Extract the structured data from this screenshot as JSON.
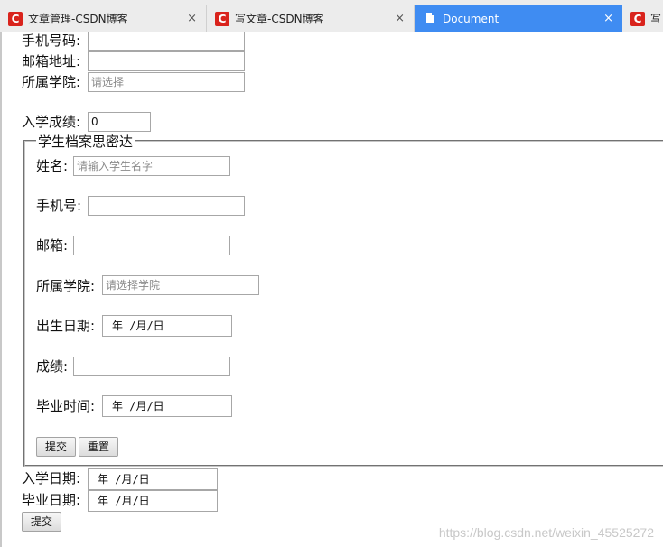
{
  "tabs": [
    {
      "title": "文章管理-CSDN博客",
      "favicon": "C"
    },
    {
      "title": "写文章-CSDN博客",
      "favicon": "C"
    },
    {
      "title": "Document",
      "favicon": "document-icon"
    },
    {
      "title": "写",
      "favicon": "C"
    }
  ],
  "tab_close_glyph": "×",
  "form": {
    "phone_label": "手机号码:",
    "email_label": "邮箱地址:",
    "college_label": "所属学院:",
    "college_placeholder": "请选择",
    "score_label": "入学成绩:",
    "score_value": "0",
    "enroll_date_label": "入学日期:",
    "grad_date_label": "毕业日期:",
    "date_placeholder": "年 /月/日",
    "submit_label": "提交"
  },
  "fieldset": {
    "legend": "学生档案思密达",
    "name_label": "姓名:",
    "name_placeholder": "请输入学生名字",
    "phone_label": "手机号:",
    "email_label": "邮箱:",
    "college_label": "所属学院:",
    "college_placeholder": "请选择学院",
    "birth_label": "出生日期:",
    "score_label": "成绩:",
    "grad_label": "毕业时间:",
    "date_placeholder": "年 /月/日",
    "submit_label": "提交",
    "reset_label": "重置"
  },
  "watermark": "https://blog.csdn.net/weixin_45525272"
}
